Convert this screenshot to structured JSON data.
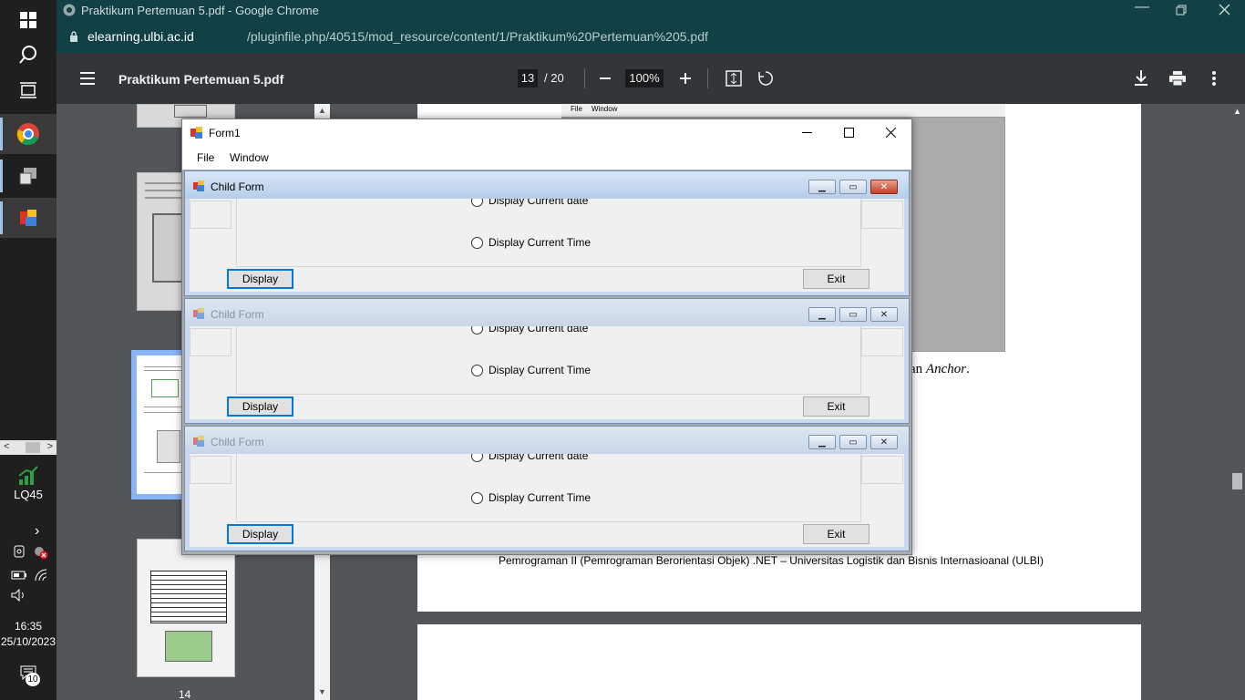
{
  "taskbar": {
    "lq45_label": "LQ45",
    "time": "16:35",
    "date": "25/10/2023",
    "notification_count": "10"
  },
  "chrome": {
    "window_title": "Praktikum Pertemuan 5.pdf - Google Chrome",
    "url_host": "elearning.ulbi.ac.id",
    "url_path": "/pluginfile.php/40515/mod_resource/content/1/Praktikum%20Pertemuan%205.pdf"
  },
  "pdf": {
    "file_name": "Praktikum Pertemuan 5.pdf",
    "current_page": "13",
    "total_pages": "/ 20",
    "zoom": "100%",
    "thumb_page_label": "14",
    "caption_fragment": "an",
    "caption_italic": "Anchor",
    "caption_end": ".",
    "footer_text": "Pemrograman II (Pemrograman Berorientasi Objek) .NET – Universitas Logistik dan Bisnis Internasioanal (ULBI)",
    "embedded_menu_file": "File",
    "embedded_menu_window": "Window"
  },
  "form1": {
    "title": "Form1",
    "menu": [
      "File",
      "Window"
    ],
    "children": [
      {
        "title": "Child Form",
        "radio1": "Display Current date",
        "radio2": "Display Current Time",
        "display_btn": "Display",
        "exit_btn": "Exit"
      },
      {
        "title": "Child Form",
        "radio1": "Display Current date",
        "radio2": "Display Current Time",
        "display_btn": "Display",
        "exit_btn": "Exit"
      },
      {
        "title": "Child Form",
        "radio1": "Display Current date",
        "radio2": "Display Current Time",
        "display_btn": "Display",
        "exit_btn": "Exit"
      }
    ]
  },
  "colors": {
    "chrome_bar": "#114047",
    "pdf_toolbar": "#323639",
    "taskbar": "#1f1f1f",
    "accent_blue": "#0078d7"
  }
}
